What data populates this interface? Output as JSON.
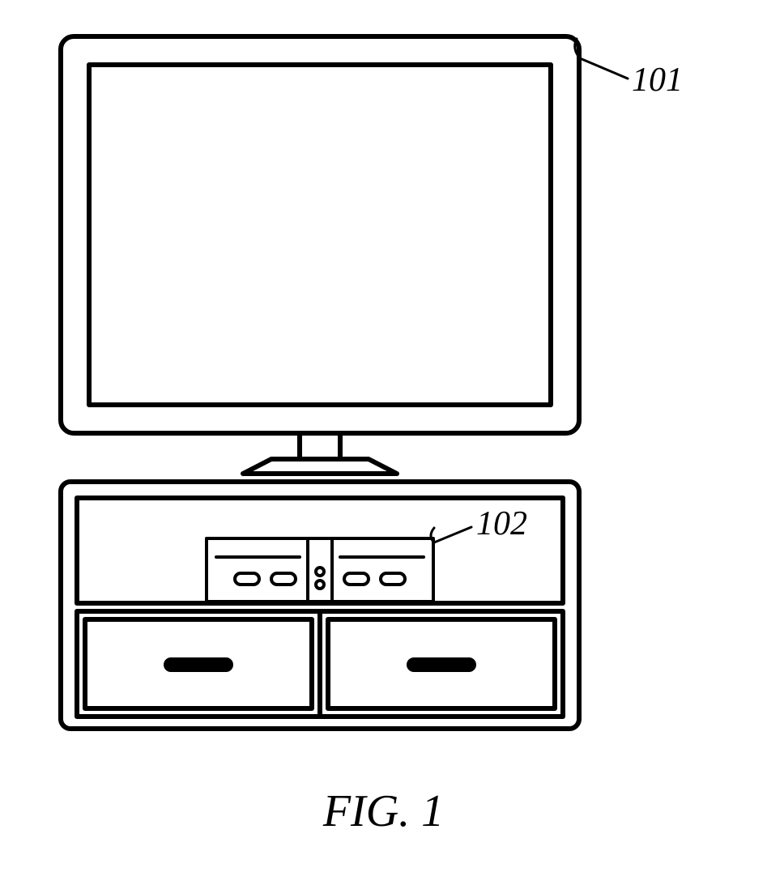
{
  "labels": {
    "tv": "101",
    "settop": "102"
  },
  "caption": "FIG. 1"
}
